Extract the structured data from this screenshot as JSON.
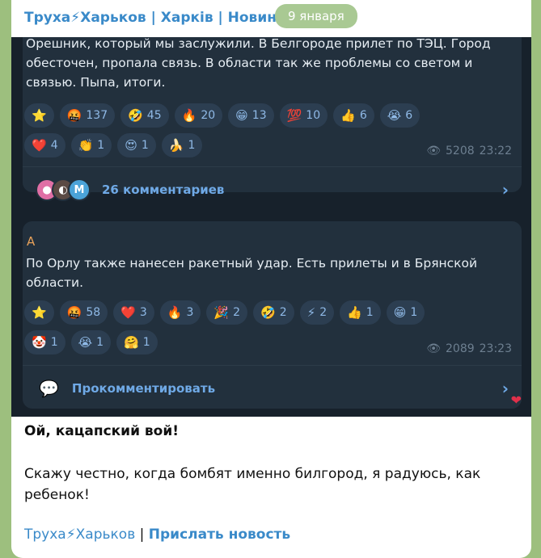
{
  "channel_title": "Труха⚡Харьков | Харків | Новини",
  "date_badge": "9 января",
  "post1": {
    "text": "Орешник, который мы заслужили. В Белгороде прилет по ТЭЦ. Город обесточен, пропала связь. В области так же проблемы со светом и связью. Пыпа, итоги.",
    "views": "5208",
    "time": "23:22",
    "comments_label": "26 комментариев",
    "reactions_row1": [
      {
        "emoji": "⭐",
        "count": ""
      },
      {
        "emoji": "🤬",
        "count": "137"
      },
      {
        "emoji": "🤣",
        "count": "45"
      },
      {
        "emoji": "🔥",
        "count": "20"
      },
      {
        "emoji": "😁",
        "count": "13"
      },
      {
        "emoji": "💯",
        "count": "10"
      },
      {
        "emoji": "👍",
        "count": "6"
      },
      {
        "emoji": "😭",
        "count": "6"
      }
    ],
    "reactions_row2": [
      {
        "emoji": "❤️",
        "count": "4"
      },
      {
        "emoji": "👏",
        "count": "1"
      },
      {
        "emoji": "😍",
        "count": "1"
      },
      {
        "emoji": "🍌",
        "count": "1"
      }
    ]
  },
  "post2": {
    "author": "A",
    "text": "По Орлу также нанесен ракетный удар. Есть прилеты и в Брянской области.",
    "views": "2089",
    "time": "23:23",
    "comment_action": "Прокомментировать",
    "reactions_row1": [
      {
        "emoji": "⭐",
        "count": ""
      },
      {
        "emoji": "🤬",
        "count": "58"
      },
      {
        "emoji": "❤️",
        "count": "3"
      },
      {
        "emoji": "🔥",
        "count": "3"
      },
      {
        "emoji": "🎉",
        "count": "2"
      },
      {
        "emoji": "🤣",
        "count": "2"
      },
      {
        "emoji": "⚡",
        "count": "2"
      },
      {
        "emoji": "👍",
        "count": "1"
      },
      {
        "emoji": "😁",
        "count": "1"
      }
    ],
    "reactions_row2": [
      {
        "emoji": "🤡",
        "count": "1"
      },
      {
        "emoji": "😭",
        "count": "1"
      },
      {
        "emoji": "🤗",
        "count": "1"
      }
    ]
  },
  "caption": {
    "headline": "Ой, кацапский вой!",
    "body": "Скажу честно, когда бомбят именно билгород, я радуюсь, как ребенок!"
  },
  "footer": {
    "channel_link": "Труха⚡Харьков",
    "separator": "|",
    "submit_link": "Прислать новость"
  },
  "colors": {
    "link": "#3a8ac9",
    "dark_bg": "#17212b",
    "card_bg": "#22303d",
    "reaction_bg": "#2c3e51"
  }
}
